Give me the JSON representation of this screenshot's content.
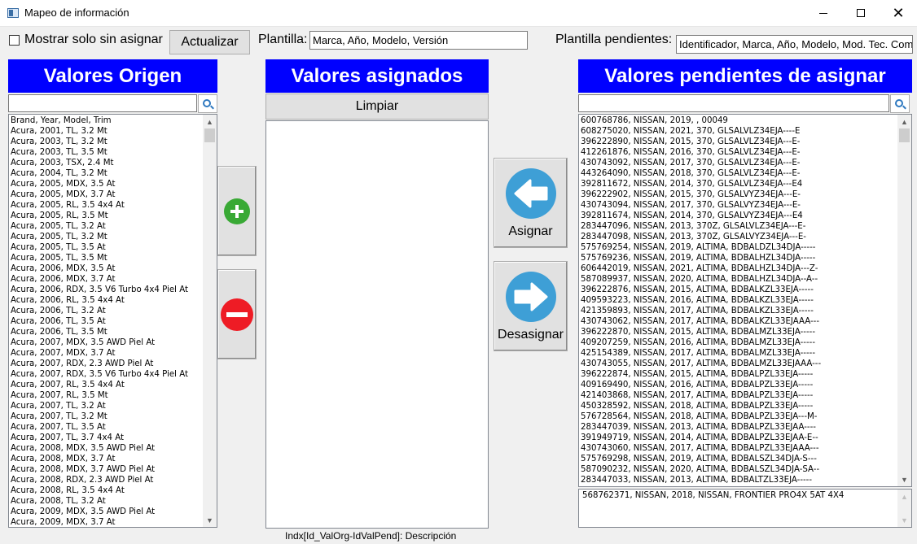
{
  "window": {
    "title": "Mapeo de información",
    "close_glyph": "✕"
  },
  "toolbar": {
    "checkbox_label": "Mostrar solo sin asignar",
    "update_label": "Actualizar",
    "plantilla_label": "Plantilla:",
    "plantilla_value": "Marca, Año, Modelo, Versión",
    "pendientes_label": "Plantilla pendientes:",
    "pendientes_value": "Identificador, Marca, Año, Modelo, Mod. Tec. Com"
  },
  "origen": {
    "title": "Valores Origen",
    "search_value": "",
    "items": [
      "Brand, Year, Model, Trim",
      "Acura, 2001, TL, 3.2 Mt",
      "Acura, 2003, TL, 3.2 Mt",
      "Acura, 2003, TL, 3.5 Mt",
      "Acura, 2003, TSX, 2.4 Mt",
      "Acura, 2004, TL, 3.2 Mt",
      "Acura, 2005, MDX, 3.5 At",
      "Acura, 2005, MDX, 3.7 At",
      "Acura, 2005, RL, 3.5 4x4 At",
      "Acura, 2005, RL, 3.5 Mt",
      "Acura, 2005, TL, 3.2 At",
      "Acura, 2005, TL, 3.2 Mt",
      "Acura, 2005, TL, 3.5 At",
      "Acura, 2005, TL, 3.5 Mt",
      "Acura, 2006, MDX, 3.5 At",
      "Acura, 2006, MDX, 3.7 At",
      "Acura, 2006, RDX, 3.5 V6 Turbo 4x4 Piel At",
      "Acura, 2006, RL, 3.5 4x4 At",
      "Acura, 2006, TL, 3.2 At",
      "Acura, 2006, TL, 3.5 At",
      "Acura, 2006, TL, 3.5 Mt",
      "Acura, 2007, MDX, 3.5 AWD Piel At",
      "Acura, 2007, MDX, 3.7 At",
      "Acura, 2007, RDX, 2.3 AWD Piel At",
      "Acura, 2007, RDX, 3.5 V6 Turbo 4x4 Piel At",
      "Acura, 2007, RL, 3.5 4x4 At",
      "Acura, 2007, RL, 3.5 Mt",
      "Acura, 2007, TL, 3.2 At",
      "Acura, 2007, TL, 3.2 Mt",
      "Acura, 2007, TL, 3.5 At",
      "Acura, 2007, TL, 3.7 4x4 At",
      "Acura, 2008, MDX, 3.5 AWD Piel At",
      "Acura, 2008, MDX, 3.7 At",
      "Acura, 2008, MDX, 3.7 AWD Piel At",
      "Acura, 2008, RDX, 2.3 AWD Piel At",
      "Acura, 2008, RL, 3.5 4x4 At",
      "Acura, 2008, TL, 3.2 At",
      "Acura, 2009, MDX, 3.5 AWD Piel At",
      "Acura, 2009, MDX, 3.7 At"
    ]
  },
  "asignados": {
    "title": "Valores asignados",
    "clear_label": "Limpiar"
  },
  "actions": {
    "add_icon": "plus-icon",
    "remove_icon": "minus-icon",
    "assign_label": "Asignar",
    "unassign_label": "Desasignar"
  },
  "pendientes": {
    "title": "Valores pendientes de asignar",
    "search_value": "",
    "items": [
      "600768786, NISSAN, 2019, , 00049",
      "608275020, NISSAN, 2021, 370, GLSALVLZ34EJA----E",
      "396222890, NISSAN, 2015, 370, GLSALVLZ34EJA---E-",
      "412261876, NISSAN, 2016, 370, GLSALVLZ34EJA---E-",
      "430743092, NISSAN, 2017, 370, GLSALVLZ34EJA---E-",
      "443264090, NISSAN, 2018, 370, GLSALVLZ34EJA---E-",
      "392811672, NISSAN, 2014, 370, GLSALVLZ34EJA---E4",
      "396222902, NISSAN, 2015, 370, GLSALVYZ34EJA---E-",
      "430743094, NISSAN, 2017, 370, GLSALVYZ34EJA---E-",
      "392811674, NISSAN, 2014, 370, GLSALVYZ34EJA---E4",
      "283447096, NISSAN, 2013, 370Z, GLSALVLZ34EJA---E-",
      "283447098, NISSAN, 2013, 370Z, GLSALVYZ34EJA---E-",
      "575769254, NISSAN, 2019, ALTIMA, BDBALDZL34DJA-----",
      "575769236, NISSAN, 2019, ALTIMA, BDBALHZL34DJA-----",
      "606442019, NISSAN, 2021, ALTIMA, BDBALHZL34DJA---Z-",
      "587089937, NISSAN, 2020, ALTIMA, BDBALHZL34DJA--A--",
      "396222876, NISSAN, 2015, ALTIMA, BDBALKZL33EJA-----",
      "409593223, NISSAN, 2016, ALTIMA, BDBALKZL33EJA-----",
      "421359893, NISSAN, 2017, ALTIMA, BDBALKZL33EJA-----",
      "430743062, NISSAN, 2017, ALTIMA, BDBALKZL33EJAAA---",
      "396222870, NISSAN, 2015, ALTIMA, BDBALMZL33EJA-----",
      "409207259, NISSAN, 2016, ALTIMA, BDBALMZL33EJA-----",
      "425154389, NISSAN, 2017, ALTIMA, BDBALMZL33EJA-----",
      "430743055, NISSAN, 2017, ALTIMA, BDBALMZL33EJAAA---",
      "396222874, NISSAN, 2015, ALTIMA, BDBALPZL33EJA-----",
      "409169490, NISSAN, 2016, ALTIMA, BDBALPZL33EJA-----",
      "421403868, NISSAN, 2017, ALTIMA, BDBALPZL33EJA-----",
      "450328592, NISSAN, 2018, ALTIMA, BDBALPZL33EJA-----",
      "576728564, NISSAN, 2018, ALTIMA, BDBALPZL33EJA---M-",
      "283447039, NISSAN, 2013, ALTIMA, BDBALPZL33EJAA----",
      "391949719, NISSAN, 2014, ALTIMA, BDBALPZL33EJAA-E--",
      "430743060, NISSAN, 2017, ALTIMA, BDBALPZL33EJAAA---",
      "575769298, NISSAN, 2019, ALTIMA, BDBALSZL34DJA-S---",
      "587090232, NISSAN, 2020, ALTIMA, BDBALSZL34DJA-SA--",
      "283447033, NISSAN, 2013, ALTIMA, BDBALTZL33EJA-----"
    ],
    "detail": "568762371, NISSAN, 2018, NISSAN, FRONTIER PRO4X 5AT 4X4"
  },
  "footer": {
    "text": "Indx[Id_ValOrg-IdValPend]: Descripción"
  },
  "colors": {
    "header_bg": "#0000ff",
    "add": "#39a935",
    "remove": "#ee1c25",
    "arrow": "#3e9fd6"
  }
}
